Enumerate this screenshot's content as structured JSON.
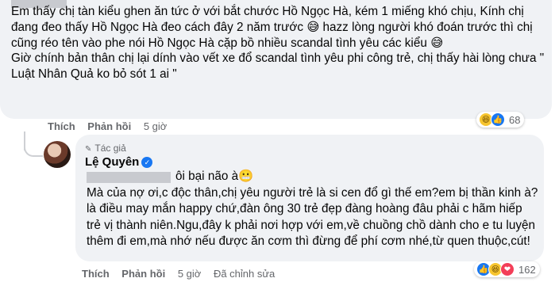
{
  "comment1": {
    "text": "Em thấy chị tàn kiểu ghen ăn tức ở với bắt chước Hồ Ngọc Hà, kém 1 miếng khó chịu, Kính chị đang đeo thấy Hồ Ngọc Hà đeo cách đây 2 năm trước 😅 hazz lòng người khó đoán trước thì chị cũng réo tên vào phe nói Hồ Ngọc Hà cặp bồ nhiều scandal tình yêu các kiểu 😅\nGiờ chính bản thân chị lại dính vào vết xe đổ scandal tình yêu phi công trẻ, chị thấy hài lòng chưa \" Luật Nhân Quả ko bỏ sót 1 ai \"",
    "actions": {
      "like": "Thích",
      "reply": "Phản hồi",
      "time": "5 giờ"
    },
    "reactions": {
      "icons": [
        "haha-icon",
        "like-icon"
      ],
      "count": "68"
    }
  },
  "comment2": {
    "author_tag": "Tác giả",
    "author": "Lệ Quyên",
    "text": "ôi bại não à😬\nMà của nợ ơi,c độc thân,chị yêu người trẻ là si cen đổ gì thế em?em bị thần kinh à?là điều may mắn happy chứ,đàn ông 30 trẻ đẹp đàng hoàng đâu phải c hãm hiếp trẻ vị thành niên.Ngu,đây k phải nơi hợp với em,về chuồng chồ dành cho e tu luyện thêm đi em,mà nhớ nếu được ăn cơm thì đừng để phí cơm nhé,từ quen thuộc,cút!",
    "actions": {
      "like": "Thích",
      "reply": "Phản hồi",
      "time": "5 giờ",
      "edited": "Đã chỉnh sửa"
    },
    "reactions": {
      "icons": [
        "like-icon",
        "haha-icon",
        "love-icon"
      ],
      "count": "162"
    }
  },
  "colors": {
    "bubble": "#f0f2f5",
    "meta": "#65676b",
    "link": "#1877f2"
  }
}
